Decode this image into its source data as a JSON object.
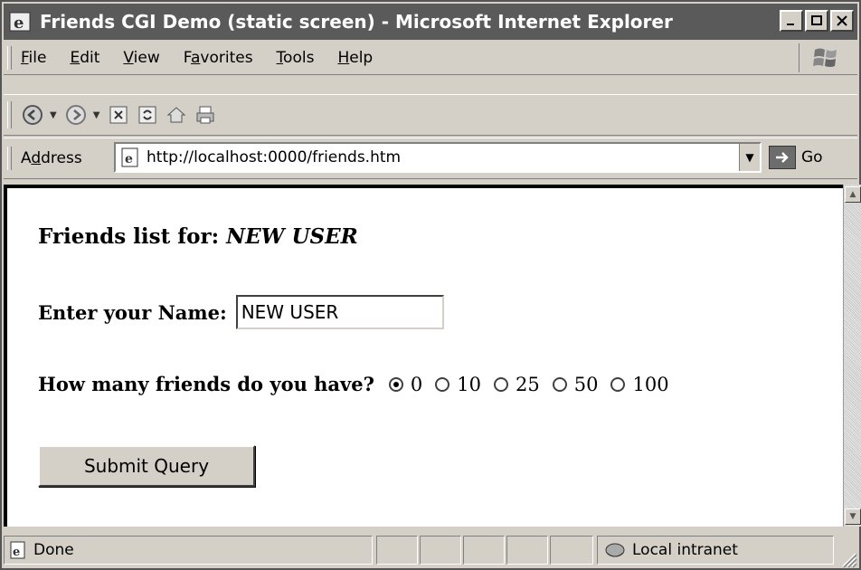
{
  "window": {
    "title": "Friends CGI Demo (static screen) - Microsoft Internet Explorer"
  },
  "menu": {
    "items": [
      {
        "first": "F",
        "rest": "ile"
      },
      {
        "first": "E",
        "rest": "dit"
      },
      {
        "first": "V",
        "rest": "iew"
      },
      {
        "pre": "F",
        "first": "a",
        "rest": "vorites"
      },
      {
        "first": "T",
        "rest": "ools"
      },
      {
        "first": "H",
        "rest": "elp"
      }
    ]
  },
  "toolbar": {
    "icons": [
      "back-icon",
      "forward-icon",
      "stop-icon",
      "refresh-icon",
      "home-icon",
      "print-icon"
    ]
  },
  "address": {
    "label_pre": "A",
    "label_ul": "d",
    "label_rest": "dress",
    "url": "http://localhost:0000/friends.htm",
    "go_label": "Go"
  },
  "page": {
    "heading_prefix": "Friends list for: ",
    "heading_user": "NEW USER",
    "name_label": "Enter your Name:",
    "name_value": "NEW USER",
    "friends_label": "How many friends do you have?",
    "friends_options": [
      "0",
      "10",
      "25",
      "50",
      "100"
    ],
    "friends_selected": "0",
    "submit_label": "Submit Query"
  },
  "status": {
    "text": "Done",
    "zone": "Local intranet"
  }
}
